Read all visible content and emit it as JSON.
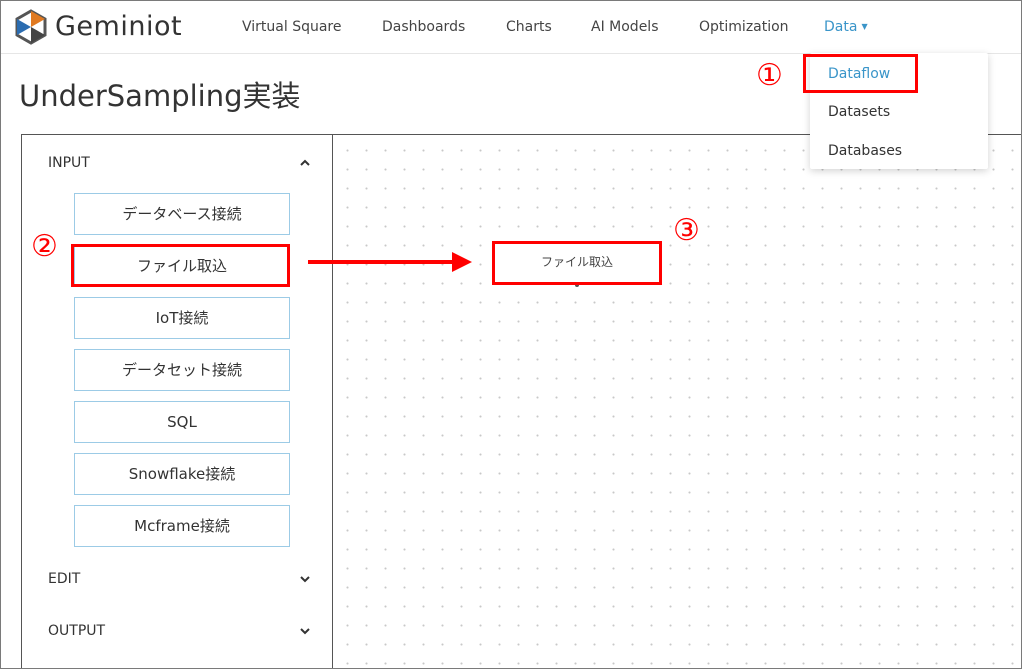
{
  "brand": {
    "name": "Geminiot"
  },
  "nav": {
    "items": [
      {
        "label": "Virtual Square"
      },
      {
        "label": "Dashboards"
      },
      {
        "label": "Charts"
      },
      {
        "label": "AI Models"
      },
      {
        "label": "Optimization"
      },
      {
        "label": "Data"
      }
    ],
    "active": "Data"
  },
  "dropdown": {
    "items": [
      {
        "label": "Dataflow"
      },
      {
        "label": "Datasets"
      },
      {
        "label": "Databases"
      }
    ]
  },
  "page": {
    "title": "UnderSampling実装"
  },
  "panel": {
    "sections": [
      {
        "label": "INPUT",
        "expanded": true
      },
      {
        "label": "EDIT",
        "expanded": false
      },
      {
        "label": "OUTPUT",
        "expanded": false
      }
    ],
    "input_tools": [
      {
        "label": "データベース接続"
      },
      {
        "label": "ファイル取込"
      },
      {
        "label": "IoT接続"
      },
      {
        "label": "データセット接続"
      },
      {
        "label": "SQL"
      },
      {
        "label": "Snowflake接続"
      },
      {
        "label": "Mcframe接続"
      }
    ]
  },
  "canvas": {
    "nodes": [
      {
        "label": "ファイル取込"
      }
    ]
  },
  "annotations": {
    "color": "#ff0000",
    "markers": [
      "①",
      "②",
      "③"
    ]
  },
  "colors": {
    "accent": "#3a95c9",
    "button_border": "#9ccbe6"
  },
  "icons": {
    "logo": "geminiot-logo-icon",
    "section_collapse": "chevron-up-icon",
    "section_expand": "chevron-down-icon",
    "dropdown_caret": "caret-down-icon"
  }
}
